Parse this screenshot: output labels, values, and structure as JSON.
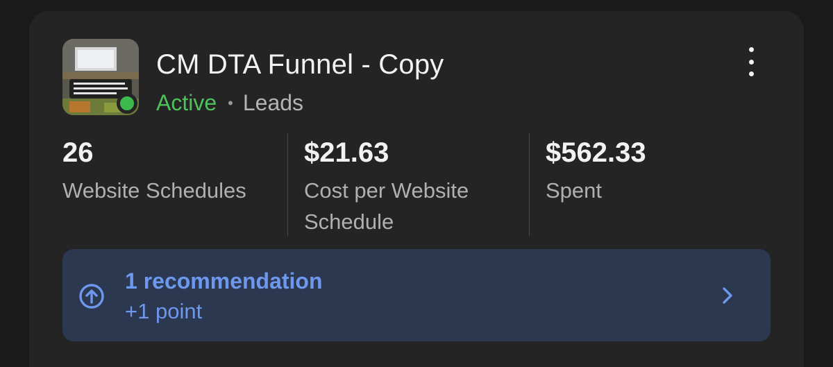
{
  "campaign": {
    "title": "CM DTA Funnel - Copy",
    "status": "Active",
    "separator": "•",
    "objective": "Leads",
    "thumbnail_caption": "When you book to get qualified credit repair sales calls!",
    "icons": {
      "menu": "more-vertical-icon",
      "status": "status-dot-icon"
    },
    "colors": {
      "status": "#4fc15a",
      "status_dot": "#3cba4e"
    }
  },
  "metrics": [
    {
      "value": "26",
      "label": "Website Schedules"
    },
    {
      "value": "$21.63",
      "label": "Cost per Website Schedule"
    },
    {
      "value": "$562.33",
      "label": "Spent"
    }
  ],
  "recommendation": {
    "title": "1 recommendation",
    "subtitle": "+1 point",
    "icons": {
      "lead": "arrow-up-circle-icon",
      "trail": "chevron-right-icon"
    },
    "colors": {
      "background": "#2c3750",
      "accent": "#6d98ee"
    }
  }
}
